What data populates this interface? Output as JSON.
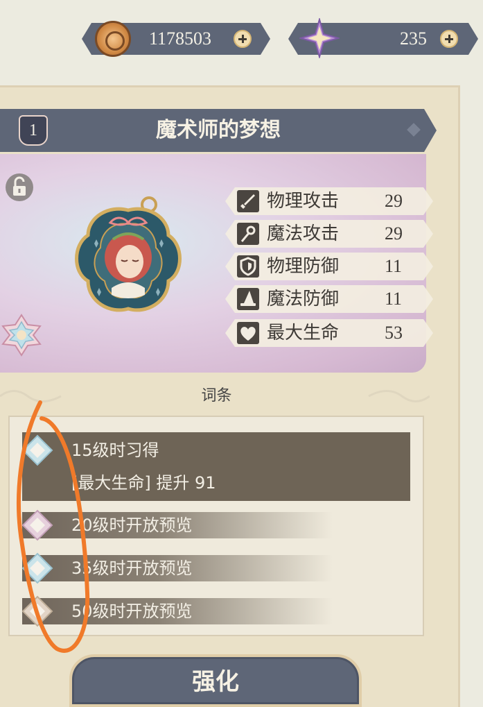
{
  "currency": {
    "coins": "1178503",
    "gems": "235",
    "coin_icon": "coin-icon",
    "gem_icon": "star-gem-icon"
  },
  "item": {
    "level": "1",
    "name": "魔术师的梦想"
  },
  "stats": [
    {
      "icon": "sword-icon",
      "label": "物理攻击",
      "value": "29"
    },
    {
      "icon": "staff-icon",
      "label": "魔法攻击",
      "value": "29"
    },
    {
      "icon": "shield-icon",
      "label": "物理防御",
      "value": "11"
    },
    {
      "icon": "wizard-hat-icon",
      "label": "魔法防御",
      "value": "11"
    },
    {
      "icon": "heart-icon",
      "label": "最大生命",
      "value": "53"
    }
  ],
  "traits_section": {
    "title": "词条",
    "traits": [
      {
        "title": "15级时习得",
        "detail": "[最大生命] 提升 91"
      },
      {
        "title": "20级时开放预览"
      },
      {
        "title": "35级时开放预览"
      },
      {
        "title": "50级时开放预览"
      }
    ]
  },
  "enhance_label": "强化",
  "colors": {
    "panel": "#eae1c8",
    "slate": "#5e6677",
    "annotation": "#f07a2a"
  }
}
